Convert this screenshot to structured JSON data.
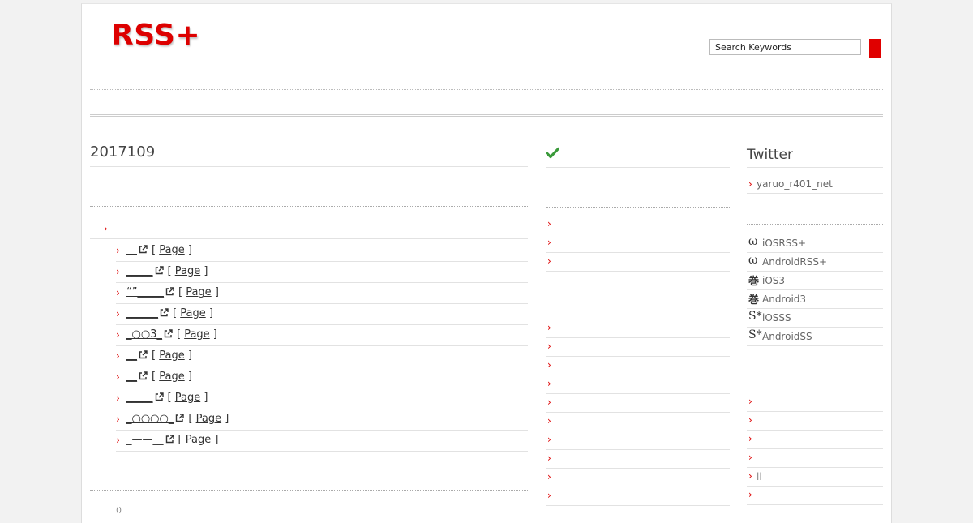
{
  "header": {
    "logo_text": "RSS+",
    "search_placeholder": "Search Keywords"
  },
  "main": {
    "title": "2017109",
    "entries": [
      {
        "title": "__",
        "page_label": "Page"
      },
      {
        "title": "_____",
        "page_label": "Page"
      },
      {
        "title": "“”_____",
        "page_label": "Page"
      },
      {
        "title": "______",
        "page_label": "Page"
      },
      {
        "title": "_○○3_",
        "page_label": "Page"
      },
      {
        "title": "__",
        "page_label": "Page"
      },
      {
        "title": "__",
        "page_label": "Page"
      },
      {
        "title": "_____",
        "page_label": "Page"
      },
      {
        "title": "_○○○○_",
        "page_label": "Page"
      },
      {
        "title": "_——__",
        "page_label": "Page"
      }
    ],
    "footer_count": "()"
  },
  "middle": {
    "list_a_count": 3,
    "list_b_count": 10
  },
  "sidebar": {
    "twitter_title": "Twitter",
    "twitter_user": "yaruo_r401_net",
    "apps": [
      {
        "icon": "omega-icon",
        "glyph": "ω",
        "label": "iOSRSS+"
      },
      {
        "icon": "omega-icon",
        "glyph": "ω",
        "label": "AndroidRSS+"
      },
      {
        "icon": "kanji-maki-icon",
        "glyph": "巻",
        "label": "iOS3"
      },
      {
        "icon": "kanji-maki-icon",
        "glyph": "巻",
        "label": "Android3"
      },
      {
        "icon": "s-star-icon",
        "glyph": "S*",
        "label": "iOSSS"
      },
      {
        "icon": "s-star-icon",
        "glyph": "S*",
        "label": "AndroidSS"
      }
    ],
    "right_list": [
      "",
      "",
      "",
      "",
      "ll",
      ""
    ]
  },
  "colors": {
    "brand_red": "#dd0000",
    "check_green": "#3a9a3a"
  }
}
